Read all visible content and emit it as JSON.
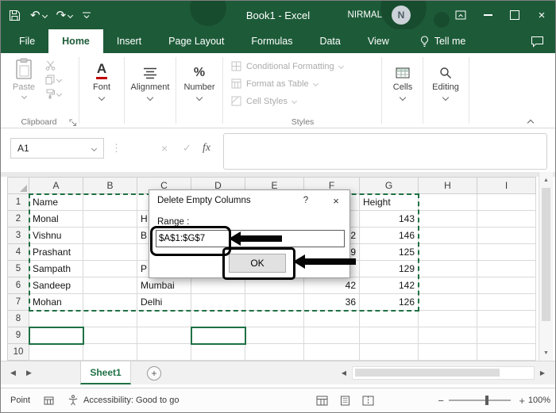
{
  "titlebar": {
    "title": "Book1 - Excel",
    "user_name": "NIRMAL",
    "user_initial": "N"
  },
  "menu": {
    "file": "File",
    "tabs": [
      "Home",
      "Insert",
      "Page Layout",
      "Formulas",
      "Data",
      "View"
    ],
    "tell_me": "Tell me"
  },
  "ribbon": {
    "paste_label": "Paste",
    "clipboard_group": "Clipboard",
    "font_icon": "A",
    "font_group": "Font",
    "alignment_group": "Alignment",
    "number_icon": "%",
    "number_group": "Number",
    "styles_items": [
      "Conditional Formatting",
      "Format as Table",
      "Cell Styles"
    ],
    "styles_group": "Styles",
    "cells_group": "Cells",
    "editing_group": "Editing"
  },
  "formula_bar": {
    "name_box_value": "A1",
    "cancel": "×",
    "enter": "✓",
    "fx_label": "fx"
  },
  "sheet": {
    "columns": [
      "A",
      "B",
      "C",
      "D",
      "E",
      "F",
      "G",
      "H",
      "I"
    ],
    "rows": [
      "1",
      "2",
      "3",
      "4",
      "5",
      "6",
      "7",
      "8",
      "9",
      "10"
    ],
    "cells": {
      "A1": "Name",
      "G1": "Height",
      "A2": "Monal",
      "C2": "H",
      "G2": "143",
      "A3": "Vishnu",
      "C3": "B",
      "F3": "2",
      "G3": "146",
      "A4": "Prashant",
      "F4": "9",
      "G4": "125",
      "A5": "Sampath",
      "C5": "P",
      "G5": "129",
      "A6": "Sandeep",
      "C6": "Mumbai",
      "F6": "42",
      "G6": "142",
      "A7": "Mohan",
      "C7": "Delhi",
      "F7": "36",
      "G7": "126"
    }
  },
  "dialog": {
    "title": "Delete Empty Columns",
    "help_button": "?",
    "close_button": "×",
    "range_label": "Range :",
    "range_value": "$A$1:$G$7",
    "ok_button": "OK"
  },
  "sheet_tabs": {
    "active_sheet": "Sheet1",
    "add_sheet": "+"
  },
  "status_bar": {
    "mode": "Point",
    "accessibility_text": "Accessibility: Good to go",
    "zoom_out": "−",
    "zoom_in": "+",
    "zoom_level": "100%"
  },
  "icons": {
    "undo": "↶",
    "redo": "↷",
    "separator_dots": "⋮",
    "close_window": "×",
    "scroll_up": "▲",
    "scroll_down": "▼",
    "scroll_left": "◀",
    "scroll_right": "▶",
    "sheet_prev": "◀",
    "sheet_next": "▶"
  },
  "colors": {
    "excel_green": "#217346",
    "titlebar_green": "#1D5B38",
    "selection_green": "#1F7145"
  }
}
